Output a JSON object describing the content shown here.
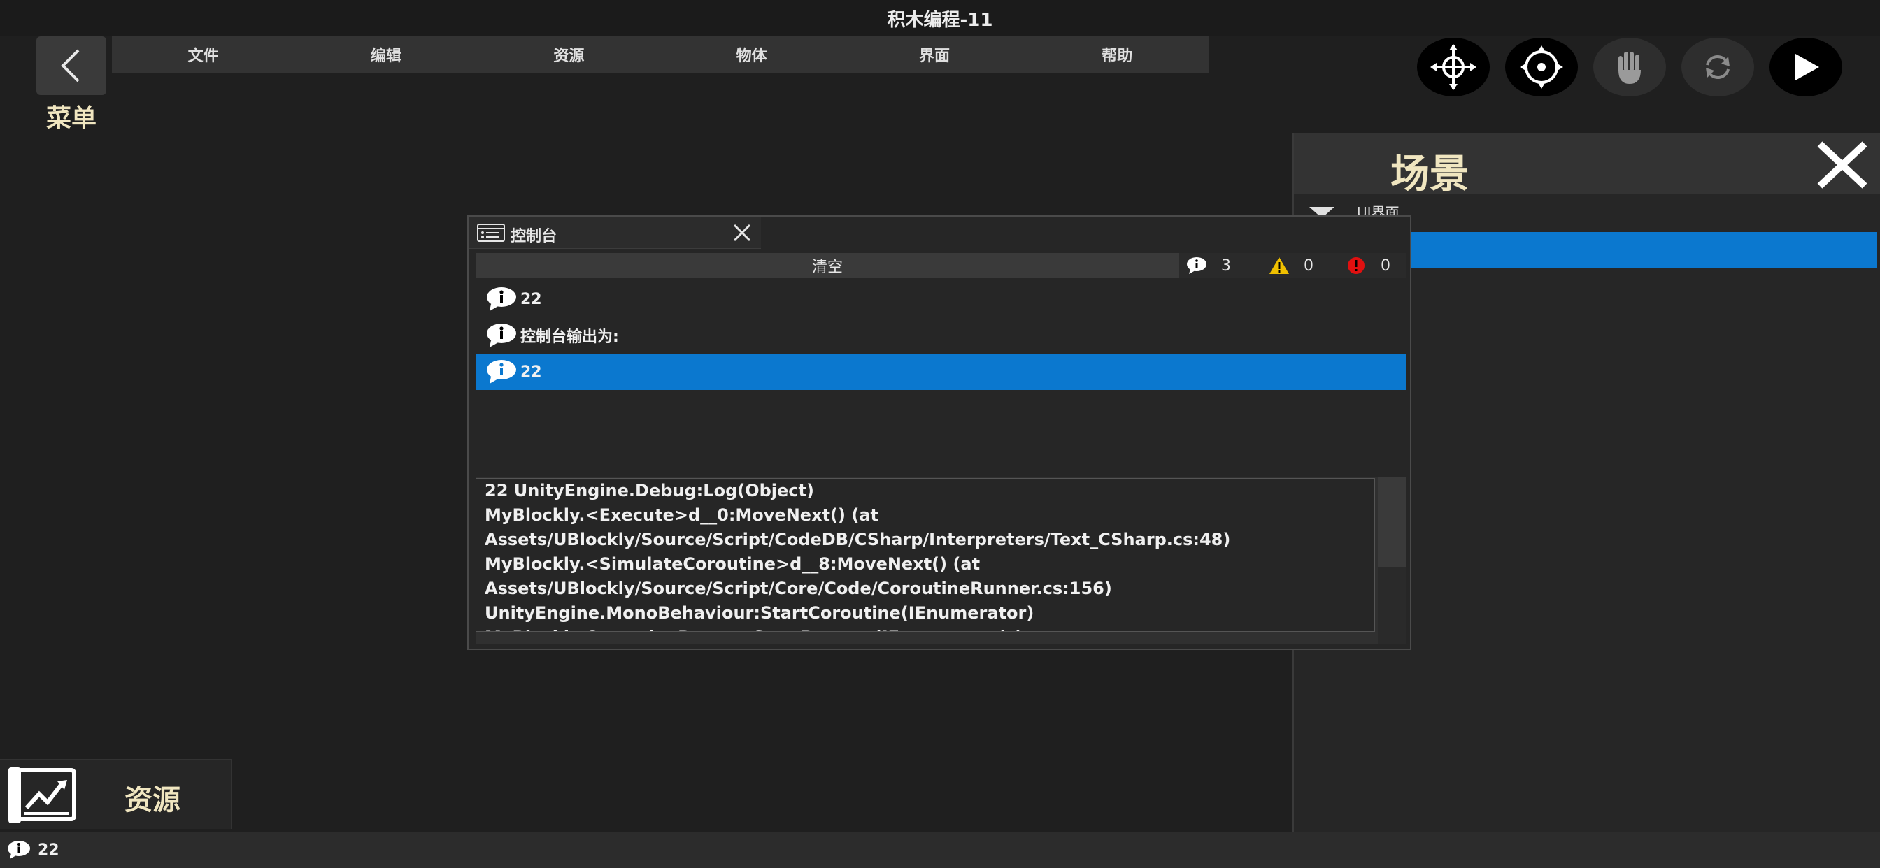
{
  "app": {
    "title": "积木编程-11"
  },
  "menu_button": {
    "label": "菜单"
  },
  "menubar": {
    "items": [
      {
        "label": "文件"
      },
      {
        "label": "编辑"
      },
      {
        "label": "资源"
      },
      {
        "label": "物体"
      },
      {
        "label": "界面"
      },
      {
        "label": "帮助"
      }
    ]
  },
  "toolbar": {
    "icons": [
      "move-icon",
      "orbit-icon",
      "hand-icon",
      "refresh-icon",
      "play-icon"
    ]
  },
  "scene": {
    "title": "场景",
    "tree_item_label": "UI界面"
  },
  "console": {
    "title": "控制台",
    "clear_label": "清空",
    "info_count": "3",
    "warning_count": "0",
    "error_count": "0",
    "logs": [
      {
        "text": "22",
        "selected": false
      },
      {
        "text": "控制台输出为:",
        "selected": false
      },
      {
        "text": "22",
        "selected": true
      }
    ],
    "stack_trace": [
      "22 UnityEngine.Debug:Log(Object)",
      "MyBlockly.<Execute>d__0:MoveNext() (at",
      "Assets/UBlockly/Source/Script/CodeDB/CSharp/Interpreters/Text_CSharp.cs:48)",
      "MyBlockly.<SimulateCoroutine>d__8:MoveNext() (at",
      "Assets/UBlockly/Source/Script/Core/Code/CoroutineRunner.cs:156)",
      "UnityEngine.MonoBehaviour:StartCoroutine(IEnumerator)",
      "MyBlockly.CoroutineRunner:StartProcess(IEnumerator) (at"
    ]
  },
  "resources": {
    "label": "资源"
  },
  "statusbar": {
    "text": "22"
  },
  "colors": {
    "selection": "#0b78cf",
    "label_gold": "#f0e6c0",
    "background": "#1f1f1f"
  }
}
